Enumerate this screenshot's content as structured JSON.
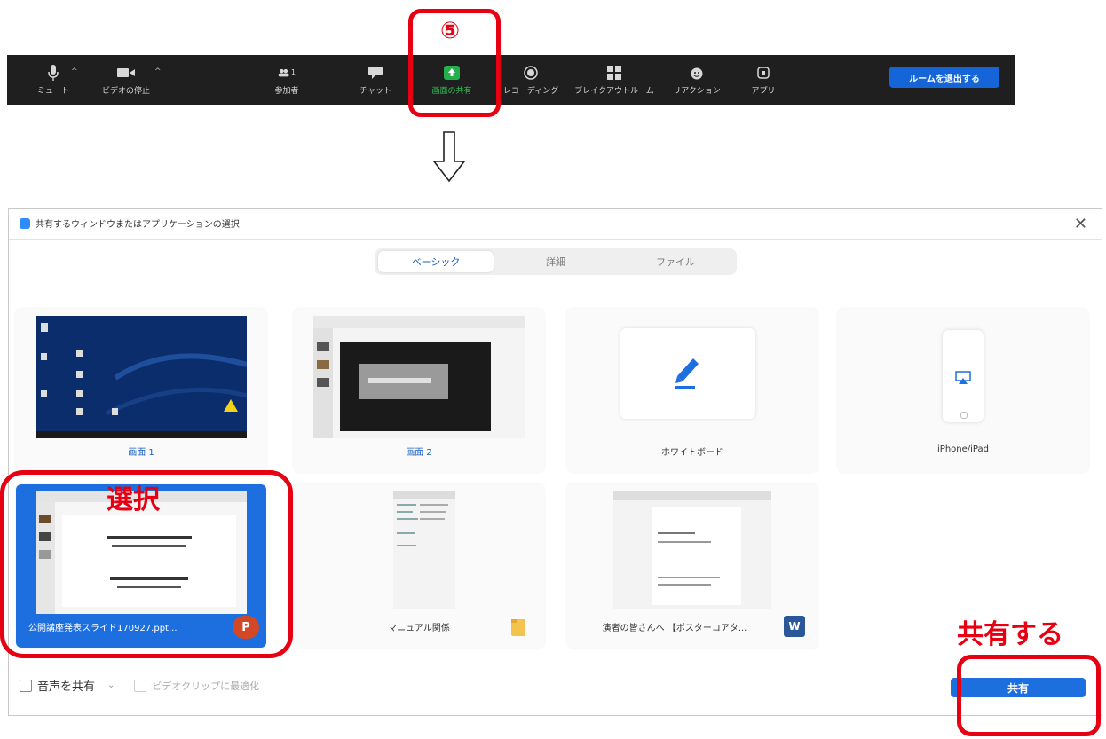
{
  "toolbar": {
    "items": [
      {
        "label": "ミュート",
        "icon": "microphone-icon"
      },
      {
        "label": "ビデオの停止",
        "icon": "video-camera-icon"
      },
      {
        "label": "参加者",
        "icon": "participants-icon",
        "count": "1"
      },
      {
        "label": "チャット",
        "icon": "chat-icon"
      },
      {
        "label": "画面の共有",
        "icon": "share-screen-icon"
      },
      {
        "label": "レコーディング",
        "icon": "record-icon"
      },
      {
        "label": "ブレイクアウトルーム",
        "icon": "breakout-rooms-icon"
      },
      {
        "label": "リアクション",
        "icon": "reaction-icon"
      },
      {
        "label": "アプリ",
        "icon": "apps-icon"
      }
    ],
    "leave_label": "ルームを退出する",
    "share_accent": "#22b14c"
  },
  "annotations": {
    "step_number": "⑤",
    "select_label": "選択",
    "share_label": "共有する",
    "red": "#e60012"
  },
  "dialog": {
    "title": "共有するウィンドウまたはアプリケーションの選択",
    "tabs": [
      "ベーシック",
      "詳細",
      "ファイル"
    ],
    "active_tab": "ベーシック",
    "tiles": [
      {
        "caption": "画面 1",
        "icon": "desktop-thumbnail"
      },
      {
        "caption": "画面 2",
        "icon": "desktop-thumbnail"
      },
      {
        "caption": "ホワイトボード",
        "icon": "pen-icon"
      },
      {
        "caption": "iPhone/iPad",
        "icon": "airplay-icon"
      },
      {
        "caption": "公開講座発表スライド170927.ppt...",
        "icon": "powerpoint-icon",
        "selected": true
      },
      {
        "caption": "マニュアル関係",
        "icon": "folder-icon"
      },
      {
        "caption": "演者の皆さんへ 【ポスターコアタ...",
        "icon": "word-icon"
      }
    ],
    "share_audio_label": "音声を共有",
    "optimize_video_label": "ビデオクリップに最適化",
    "share_button": "共有",
    "accent": "#1d6fe0"
  }
}
